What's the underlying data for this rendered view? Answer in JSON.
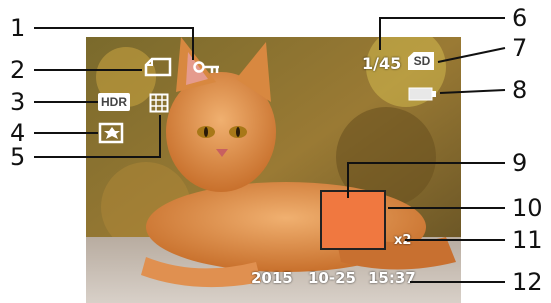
{
  "callouts": [
    "1",
    "2",
    "3",
    "4",
    "5",
    "6",
    "7",
    "8",
    "9",
    "10",
    "11",
    "12"
  ],
  "overlay": {
    "shot_count": "1/45",
    "storage_label": "SD",
    "hdr_label": "HDR",
    "zoom": "x2",
    "date": "2015 10-25",
    "time": "15:37"
  },
  "colors": {
    "focus_frame": "#f07840",
    "leader_line": "#111111",
    "overlay_text": "#ffffff"
  },
  "icons": [
    "key-protect-icon",
    "page-icon",
    "hdr-icon",
    "exposure-icon",
    "grid-icon",
    "sd-card-icon",
    "battery-icon"
  ]
}
